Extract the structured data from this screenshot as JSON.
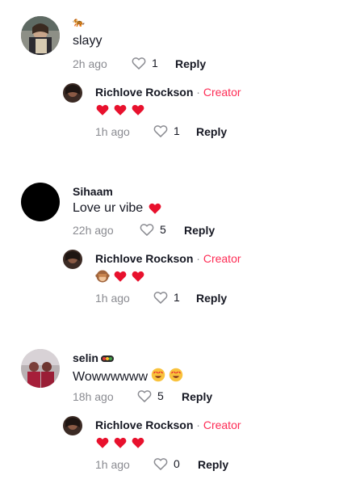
{
  "comments": [
    {
      "username": "",
      "flag": "🐅",
      "text": "slayy",
      "time": "2h ago",
      "likes": "1",
      "reply_label": "Reply",
      "reply": {
        "username": "Richlove Rockson",
        "sep": " · ",
        "badge": "Creator",
        "emojis": [
          "red-heart",
          "red-heart",
          "red-heart"
        ],
        "time": "1h ago",
        "likes": "1",
        "reply_label": "Reply"
      }
    },
    {
      "username": "Sihaam",
      "text": "Love ur vibe",
      "time": "22h ago",
      "likes": "5",
      "reply_label": "Reply",
      "reply": {
        "username": "Richlove Rockson",
        "sep": " · ",
        "badge": "Creator",
        "emojis": [
          "see-no-evil-monkey",
          "red-heart",
          "red-heart"
        ],
        "time": "1h ago",
        "likes": "1",
        "reply_label": "Reply"
      }
    },
    {
      "username": "selin",
      "text": "Wowwwwww",
      "time": "18h ago",
      "likes": "5",
      "reply_label": "Reply",
      "reply": {
        "username": "Richlove Rockson",
        "sep": " · ",
        "badge": "Creator",
        "emojis": [
          "red-heart",
          "red-heart",
          "red-heart"
        ],
        "time": "1h ago",
        "likes": "0",
        "reply_label": "Reply"
      }
    }
  ],
  "colors": {
    "creator": "#fe2c55",
    "meta": "#8a8b91",
    "heart": "#fe2c55"
  }
}
